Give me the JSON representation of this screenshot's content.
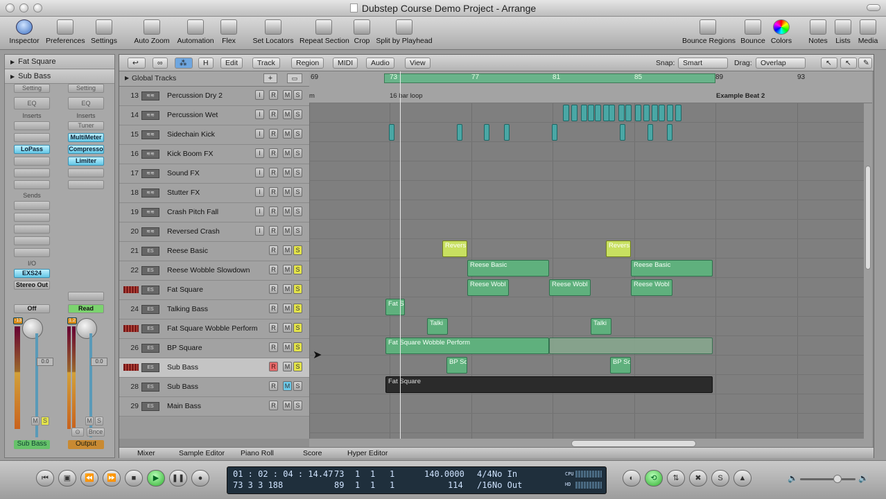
{
  "window": {
    "title": "Dubstep Course Demo Project - Arrange"
  },
  "toolbar": {
    "left": [
      "Inspector",
      "Preferences",
      "Settings",
      "Auto Zoom",
      "Automation",
      "Flex",
      "Set Locators",
      "Repeat Section",
      "Crop",
      "Split by Playhead"
    ],
    "right": [
      "Bounce Regions",
      "Bounce",
      "Colors",
      "Notes",
      "Lists",
      "Media"
    ]
  },
  "inspector": {
    "region_header": "Fat Square",
    "track_header": "Sub Bass",
    "setting": "Setting",
    "eq": "EQ",
    "inserts": "Inserts",
    "tuner": "Tuner",
    "strip1_inserts": [
      "LoPass"
    ],
    "strip2_inserts": [
      "MultiMeter",
      "Compresso",
      "Limiter"
    ],
    "sends": "Sends",
    "io": "I/O",
    "input": "EXS24",
    "output": "Stereo Out",
    "auto1": "Off",
    "auto2": "Read",
    "peak1": "-13",
    "peak2": "1.2",
    "fader1": "0.0",
    "fader2": "0.0",
    "m": "M",
    "s": "S",
    "link": "⊙",
    "bnce": "Bnce",
    "name1": "Sub Bass",
    "name2": "Output"
  },
  "localbar": {
    "menus": [
      "Edit",
      "Track",
      "Region",
      "MIDI",
      "Audio",
      "View"
    ],
    "h_label": "H",
    "snap_label": "Snap:",
    "snap_value": "Smart",
    "drag_label": "Drag:",
    "drag_value": "Overlap"
  },
  "global_tracks": "Global Tracks",
  "ruler": {
    "bars": [
      "69",
      "73",
      "77",
      "81",
      "85",
      "89",
      "93"
    ],
    "loop_label": "16 bar loop",
    "marker_label": "Example Beat 2",
    "start_marker": "m"
  },
  "tracks": [
    {
      "num": "13",
      "name": "Percussion Dry 2",
      "i": true
    },
    {
      "num": "14",
      "name": "Percussion Wet",
      "i": true
    },
    {
      "num": "15",
      "name": "Sidechain Kick",
      "i": true
    },
    {
      "num": "16",
      "name": "Kick Boom FX",
      "i": true
    },
    {
      "num": "17",
      "name": "Sound FX",
      "i": true
    },
    {
      "num": "18",
      "name": "Stutter FX",
      "i": true
    },
    {
      "num": "19",
      "name": "Crash Pitch Fall",
      "i": true
    },
    {
      "num": "20",
      "name": "Reversed Crash",
      "i": true
    },
    {
      "num": "21",
      "name": "Reese Basic",
      "i": false
    },
    {
      "num": "22",
      "name": "Reese Wobble Slowdown",
      "i": false
    },
    {
      "num": "23",
      "name": "Fat Square",
      "i": false
    },
    {
      "num": "24",
      "name": "Talking Bass",
      "i": false
    },
    {
      "num": "25",
      "name": "Fat Square Wobble Perform",
      "i": false
    },
    {
      "num": "26",
      "name": "BP Square",
      "i": false
    },
    {
      "num": "27",
      "name": "Sub Bass",
      "i": false
    },
    {
      "num": "28",
      "name": "Sub Bass",
      "i": false
    },
    {
      "num": "29",
      "name": "Main Bass",
      "i": false
    }
  ],
  "track_buttons": {
    "i": "I",
    "r": "R",
    "m": "M",
    "s": "S"
  },
  "regions": {
    "reversed": "Revers",
    "reese_basic": "Reese Basic",
    "reese_wobble": "Reese Wobl",
    "fat_s": "Fat S",
    "talking": "Talki",
    "fat_wobble": "Fat Square Wobble Perform",
    "bp": "BP Sq",
    "fat_square": "Fat Square"
  },
  "bottom_tabs": [
    "Mixer",
    "Sample Editor",
    "Piano Roll",
    "Score",
    "Hyper Editor"
  ],
  "transport": {
    "smpte": "01 : 02 : 04 : 14.47",
    "bars": [
      "73",
      "1",
      "1",
      "1"
    ],
    "bars2": [
      "89",
      "1",
      "1",
      "1"
    ],
    "pos2": "73   3   3 188",
    "tempo": "140.0000",
    "tempo2": "114",
    "sig": "4/4",
    "sig2": "/16",
    "in": "No In",
    "out": "No Out",
    "cpu": "CPU",
    "hd": "HD"
  },
  "colors": {
    "region_green": "#5fb07d",
    "region_yellow": "#c8e060",
    "region_teal": "#4aa7a5",
    "cycle": "#69b38a"
  }
}
